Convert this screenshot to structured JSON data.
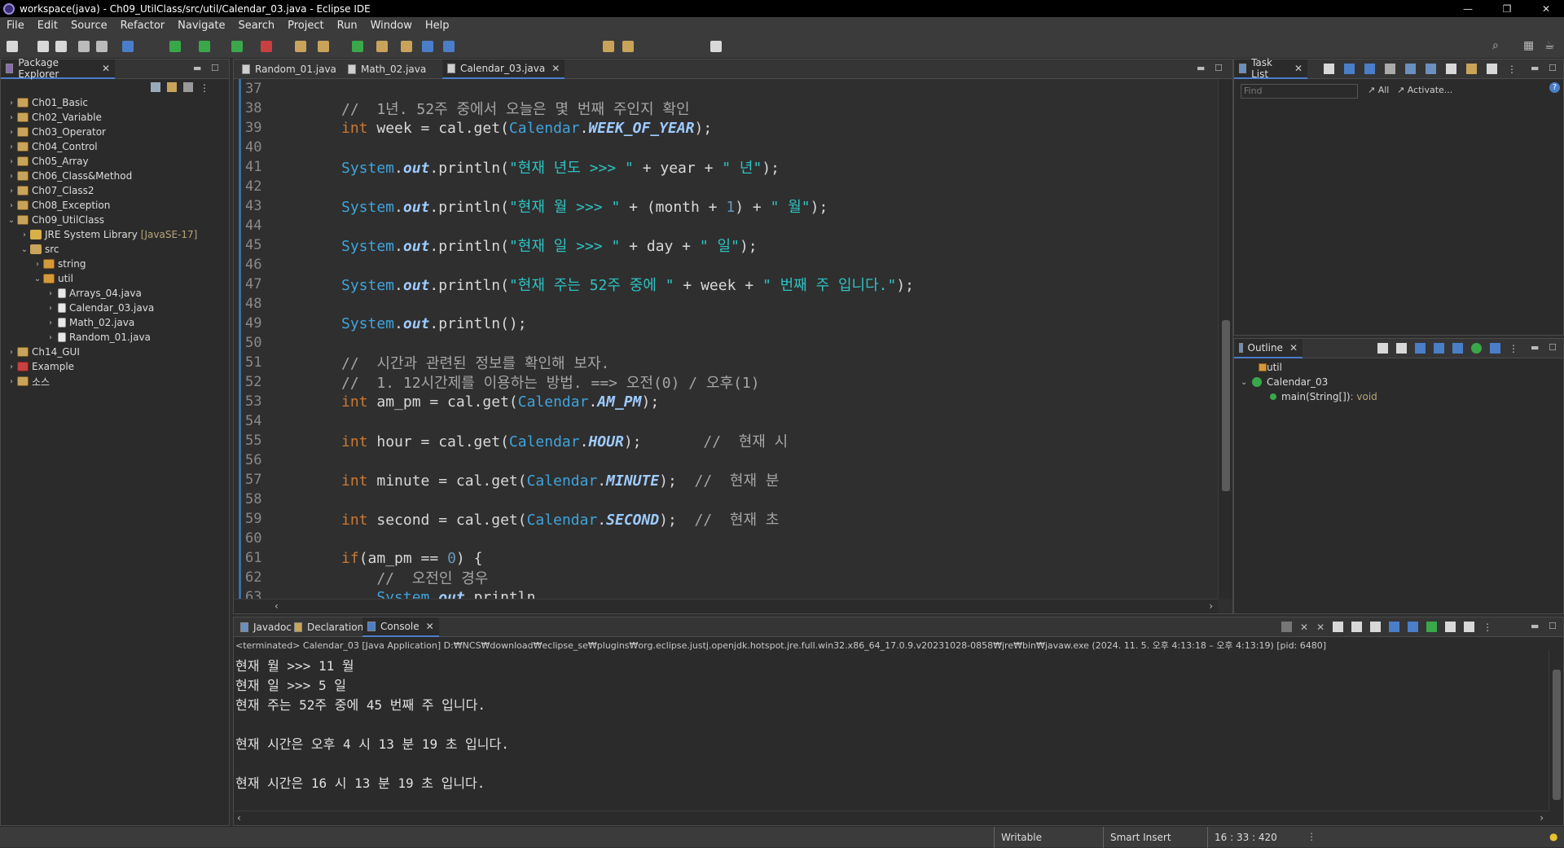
{
  "window": {
    "title": "workspace(java) - Ch09_UtilClass/src/util/Calendar_03.java - Eclipse IDE",
    "min": "—",
    "max": "❐",
    "close": "✕"
  },
  "menu": [
    "File",
    "Edit",
    "Source",
    "Refactor",
    "Navigate",
    "Search",
    "Project",
    "Run",
    "Window",
    "Help"
  ],
  "package_explorer": {
    "title": "Package Explorer",
    "items": [
      {
        "label": "Ch01_Basic",
        "level": 0,
        "arrow": "›",
        "icon": "proj"
      },
      {
        "label": "Ch02_Variable",
        "level": 0,
        "arrow": "›",
        "icon": "proj"
      },
      {
        "label": "Ch03_Operator",
        "level": 0,
        "arrow": "›",
        "icon": "proj"
      },
      {
        "label": "Ch04_Control",
        "level": 0,
        "arrow": "›",
        "icon": "proj"
      },
      {
        "label": "Ch05_Array",
        "level": 0,
        "arrow": "›",
        "icon": "proj"
      },
      {
        "label": "Ch06_Class&Method",
        "level": 0,
        "arrow": "›",
        "icon": "proj"
      },
      {
        "label": "Ch07_Class2",
        "level": 0,
        "arrow": "›",
        "icon": "proj"
      },
      {
        "label": "Ch08_Exception",
        "level": 0,
        "arrow": "›",
        "icon": "proj"
      },
      {
        "label": "Ch09_UtilClass",
        "level": 0,
        "arrow": "⌄",
        "icon": "proj"
      },
      {
        "label": "JRE System Library",
        "extra": "[JavaSE-17]",
        "level": 1,
        "arrow": "›",
        "icon": "lib"
      },
      {
        "label": "src",
        "level": 1,
        "arrow": "⌄",
        "icon": "src"
      },
      {
        "label": "string",
        "level": 2,
        "arrow": "›",
        "icon": "pkg"
      },
      {
        "label": "util",
        "level": 2,
        "arrow": "⌄",
        "icon": "pkg"
      },
      {
        "label": "Arrays_04.java",
        "level": 3,
        "arrow": "›",
        "icon": "java"
      },
      {
        "label": "Calendar_03.java",
        "level": 3,
        "arrow": "›",
        "icon": "java"
      },
      {
        "label": "Math_02.java",
        "level": 3,
        "arrow": "›",
        "icon": "java"
      },
      {
        "label": "Random_01.java",
        "level": 3,
        "arrow": "›",
        "icon": "java"
      },
      {
        "label": "Ch14_GUI",
        "level": 0,
        "arrow": "›",
        "icon": "proj"
      },
      {
        "label": "Example",
        "level": 0,
        "arrow": "›",
        "icon": "red"
      },
      {
        "label": "소스",
        "level": 0,
        "arrow": "›",
        "icon": "proj"
      }
    ]
  },
  "editor": {
    "tabs": [
      {
        "label": "Random_01.java",
        "active": false
      },
      {
        "label": "Math_02.java",
        "active": false
      },
      {
        "label": "Calendar_03.java",
        "active": true
      }
    ],
    "lines": [
      {
        "n": "37",
        "html": ""
      },
      {
        "n": "38",
        "html": "<span class='c'>//  1년. 52주 중에서 오늘은 몇 번째 주인지 확인</span>"
      },
      {
        "n": "39",
        "html": "<span class='k'>int</span><span class='t'> week = cal.get(</span><span class='cls'>Calendar</span><span class='t'>.</span><span class='fld'>WEEK_OF_YEAR</span><span class='t'>);</span>"
      },
      {
        "n": "40",
        "html": ""
      },
      {
        "n": "41",
        "html": "<span class='cls'>System</span><span class='t'>.</span><span class='fld'>out</span><span class='t'>.println(</span><span class='s'>\"현재 년도 >>> \"</span><span class='t'> + year + </span><span class='s'>\" 년\"</span><span class='t'>);</span>"
      },
      {
        "n": "42",
        "html": ""
      },
      {
        "n": "43",
        "html": "<span class='cls'>System</span><span class='t'>.</span><span class='fld'>out</span><span class='t'>.println(</span><span class='s'>\"현재 월 >>> \"</span><span class='t'> + (month + </span><span class='num'>1</span><span class='t'>) + </span><span class='s'>\" 월\"</span><span class='t'>);</span>"
      },
      {
        "n": "44",
        "html": ""
      },
      {
        "n": "45",
        "html": "<span class='cls'>System</span><span class='t'>.</span><span class='fld'>out</span><span class='t'>.println(</span><span class='s'>\"현재 일 >>> \"</span><span class='t'> + day + </span><span class='s'>\" 일\"</span><span class='t'>);</span>"
      },
      {
        "n": "46",
        "html": ""
      },
      {
        "n": "47",
        "html": "<span class='cls'>System</span><span class='t'>.</span><span class='fld'>out</span><span class='t'>.println(</span><span class='s'>\"현재 주는 52주 중에 \"</span><span class='t'> + week + </span><span class='s'>\" 번째 주 입니다.\"</span><span class='t'>);</span>"
      },
      {
        "n": "48",
        "html": ""
      },
      {
        "n": "49",
        "html": "<span class='cls'>System</span><span class='t'>.</span><span class='fld'>out</span><span class='t'>.println();</span>"
      },
      {
        "n": "50",
        "html": ""
      },
      {
        "n": "51",
        "html": "<span class='c'>//  시간과 관련된 정보를 확인해 보자.</span>"
      },
      {
        "n": "52",
        "html": "<span class='c'>//  1. 12시간제를 이용하는 방법. ==> 오전(0) / 오후(1)</span>"
      },
      {
        "n": "53",
        "html": "<span class='k'>int</span><span class='t'> am_pm = cal.get(</span><span class='cls'>Calendar</span><span class='t'>.</span><span class='fld'>AM_PM</span><span class='t'>);</span>"
      },
      {
        "n": "54",
        "html": ""
      },
      {
        "n": "55",
        "html": "<span class='k'>int</span><span class='t'> hour = cal.get(</span><span class='cls'>Calendar</span><span class='t'>.</span><span class='fld'>HOUR</span><span class='t'>);       </span><span class='c'>//  현재 시</span>"
      },
      {
        "n": "56",
        "html": ""
      },
      {
        "n": "57",
        "html": "<span class='k'>int</span><span class='t'> minute = cal.get(</span><span class='cls'>Calendar</span><span class='t'>.</span><span class='fld'>MINUTE</span><span class='t'>);  </span><span class='c'>//  현재 분</span>"
      },
      {
        "n": "58",
        "html": ""
      },
      {
        "n": "59",
        "html": "<span class='k'>int</span><span class='t'> second = cal.get(</span><span class='cls'>Calendar</span><span class='t'>.</span><span class='fld'>SECOND</span><span class='t'>);  </span><span class='c'>//  현재 초</span>"
      },
      {
        "n": "60",
        "html": ""
      },
      {
        "n": "61",
        "html": "<span class='k'>if</span><span class='t'>(am_pm == </span><span class='num'>0</span><span class='t'>) {</span>"
      },
      {
        "n": "62",
        "html": "<span class='c'>    //  오전인 경우</span>"
      },
      {
        "n": "63",
        "html": "<span class='cls'>    System</span><span class='t'>.</span><span class='fld'>out</span><span class='t'>.println</span>"
      }
    ]
  },
  "task_list": {
    "title": "Task List",
    "find_placeholder": "Find",
    "all": "All",
    "activate": "Activate..."
  },
  "outline": {
    "title": "Outline",
    "package": "util",
    "class": "Calendar_03",
    "method": "main(String[])",
    "method_type": " : void"
  },
  "console": {
    "tabs": [
      {
        "label": "Javadoc"
      },
      {
        "label": "Declaration"
      },
      {
        "label": "Console"
      }
    ],
    "info": "<terminated> Calendar_03 [Java Application] D:₩NCS₩download₩eclipse_se₩plugins₩org.eclipse.justj.openjdk.hotspot.jre.full.win32.x86_64_17.0.9.v20231028-0858₩jre₩bin₩javaw.exe  (2024. 11. 5. 오후 4:13:18 – 오후 4:13:19) [pid: 6480]",
    "output": [
      "현재 월 >>> 11 월",
      "현재 일 >>> 5 일",
      "현재 주는 52주 중에 45 번째 주 입니다.",
      "",
      "현재 시간은 오후 4 시 13 분 19 초 입니다.",
      "",
      "현재 시간은 16 시 13 분 19 초 입니다."
    ]
  },
  "status": {
    "writable": "Writable",
    "insert": "Smart Insert",
    "position": "16 : 33 : 420"
  }
}
